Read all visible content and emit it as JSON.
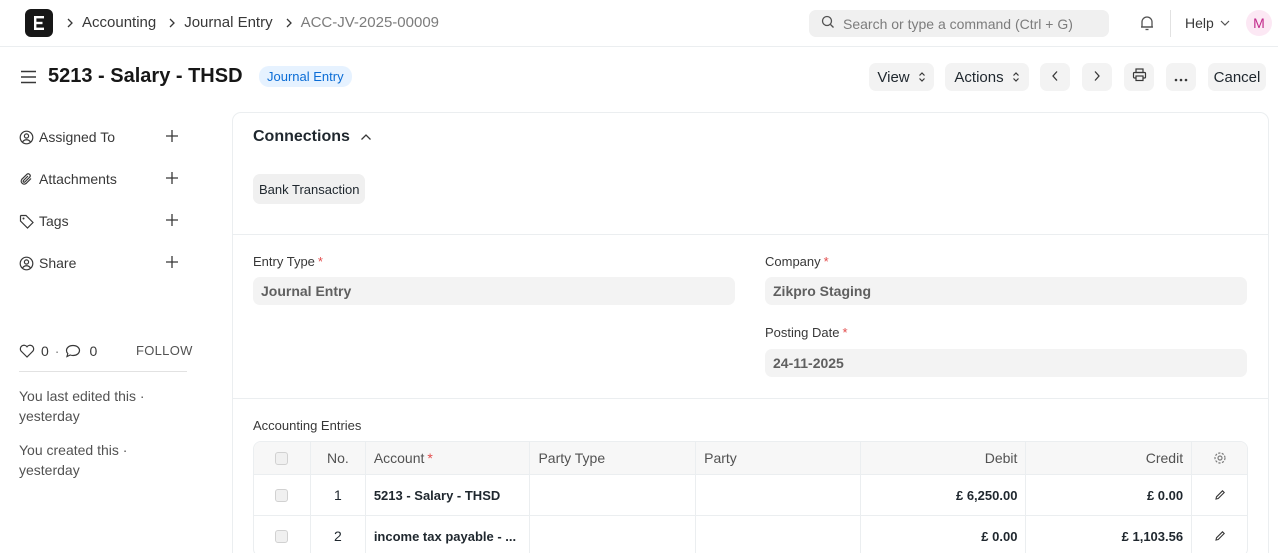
{
  "navbar": {
    "logo_letter": "E",
    "breadcrumbs": [
      "Accounting",
      "Journal Entry",
      "ACC-JV-2025-00009"
    ],
    "search_placeholder": "Search or type a command (Ctrl + G)",
    "help_label": "Help",
    "avatar_initial": "M"
  },
  "page": {
    "title": "5213 - Salary - THSD",
    "status_badge": "Journal Entry",
    "buttons": {
      "view": "View",
      "actions": "Actions",
      "cancel": "Cancel"
    }
  },
  "sidebar": {
    "items": [
      {
        "label": "Assigned To",
        "icon": "assign-icon"
      },
      {
        "label": "Attachments",
        "icon": "paperclip-icon"
      },
      {
        "label": "Tags",
        "icon": "tag-icon"
      },
      {
        "label": "Share",
        "icon": "share-icon"
      }
    ],
    "likes": "0",
    "comments": "0",
    "separator": "·",
    "follow_label": "FOLLOW",
    "activity": [
      "You last edited this · yesterday",
      "You created this · yesterday"
    ]
  },
  "connections": {
    "title": "Connections",
    "chips": [
      "Bank Transaction"
    ]
  },
  "form": {
    "entry_type_label": "Entry Type",
    "entry_type_value": "Journal Entry",
    "company_label": "Company",
    "company_value": "Zikpro Staging",
    "posting_date_label": "Posting Date",
    "posting_date_value": "24-11-2025",
    "required_mark": "*"
  },
  "table": {
    "label": "Accounting Entries",
    "headers": {
      "no": "No.",
      "account": "Account",
      "party_type": "Party Type",
      "party": "Party",
      "debit": "Debit",
      "credit": "Credit"
    },
    "rows": [
      {
        "no": "1",
        "account": "5213 - Salary - THSD",
        "party_type": "",
        "party": "",
        "debit": "£ 6,250.00",
        "credit": "£ 0.00"
      },
      {
        "no": "2",
        "account": "income tax payable - ...",
        "party_type": "",
        "party": "",
        "debit": "£ 0.00",
        "credit": "£ 1,103.56"
      }
    ]
  },
  "colors": {
    "badge_bg": "#e6f2ff",
    "badge_text": "#0b6dd6",
    "required": "#e24c4c",
    "avatar_bg": "#fce8f4",
    "avatar_text": "#c1298a"
  }
}
